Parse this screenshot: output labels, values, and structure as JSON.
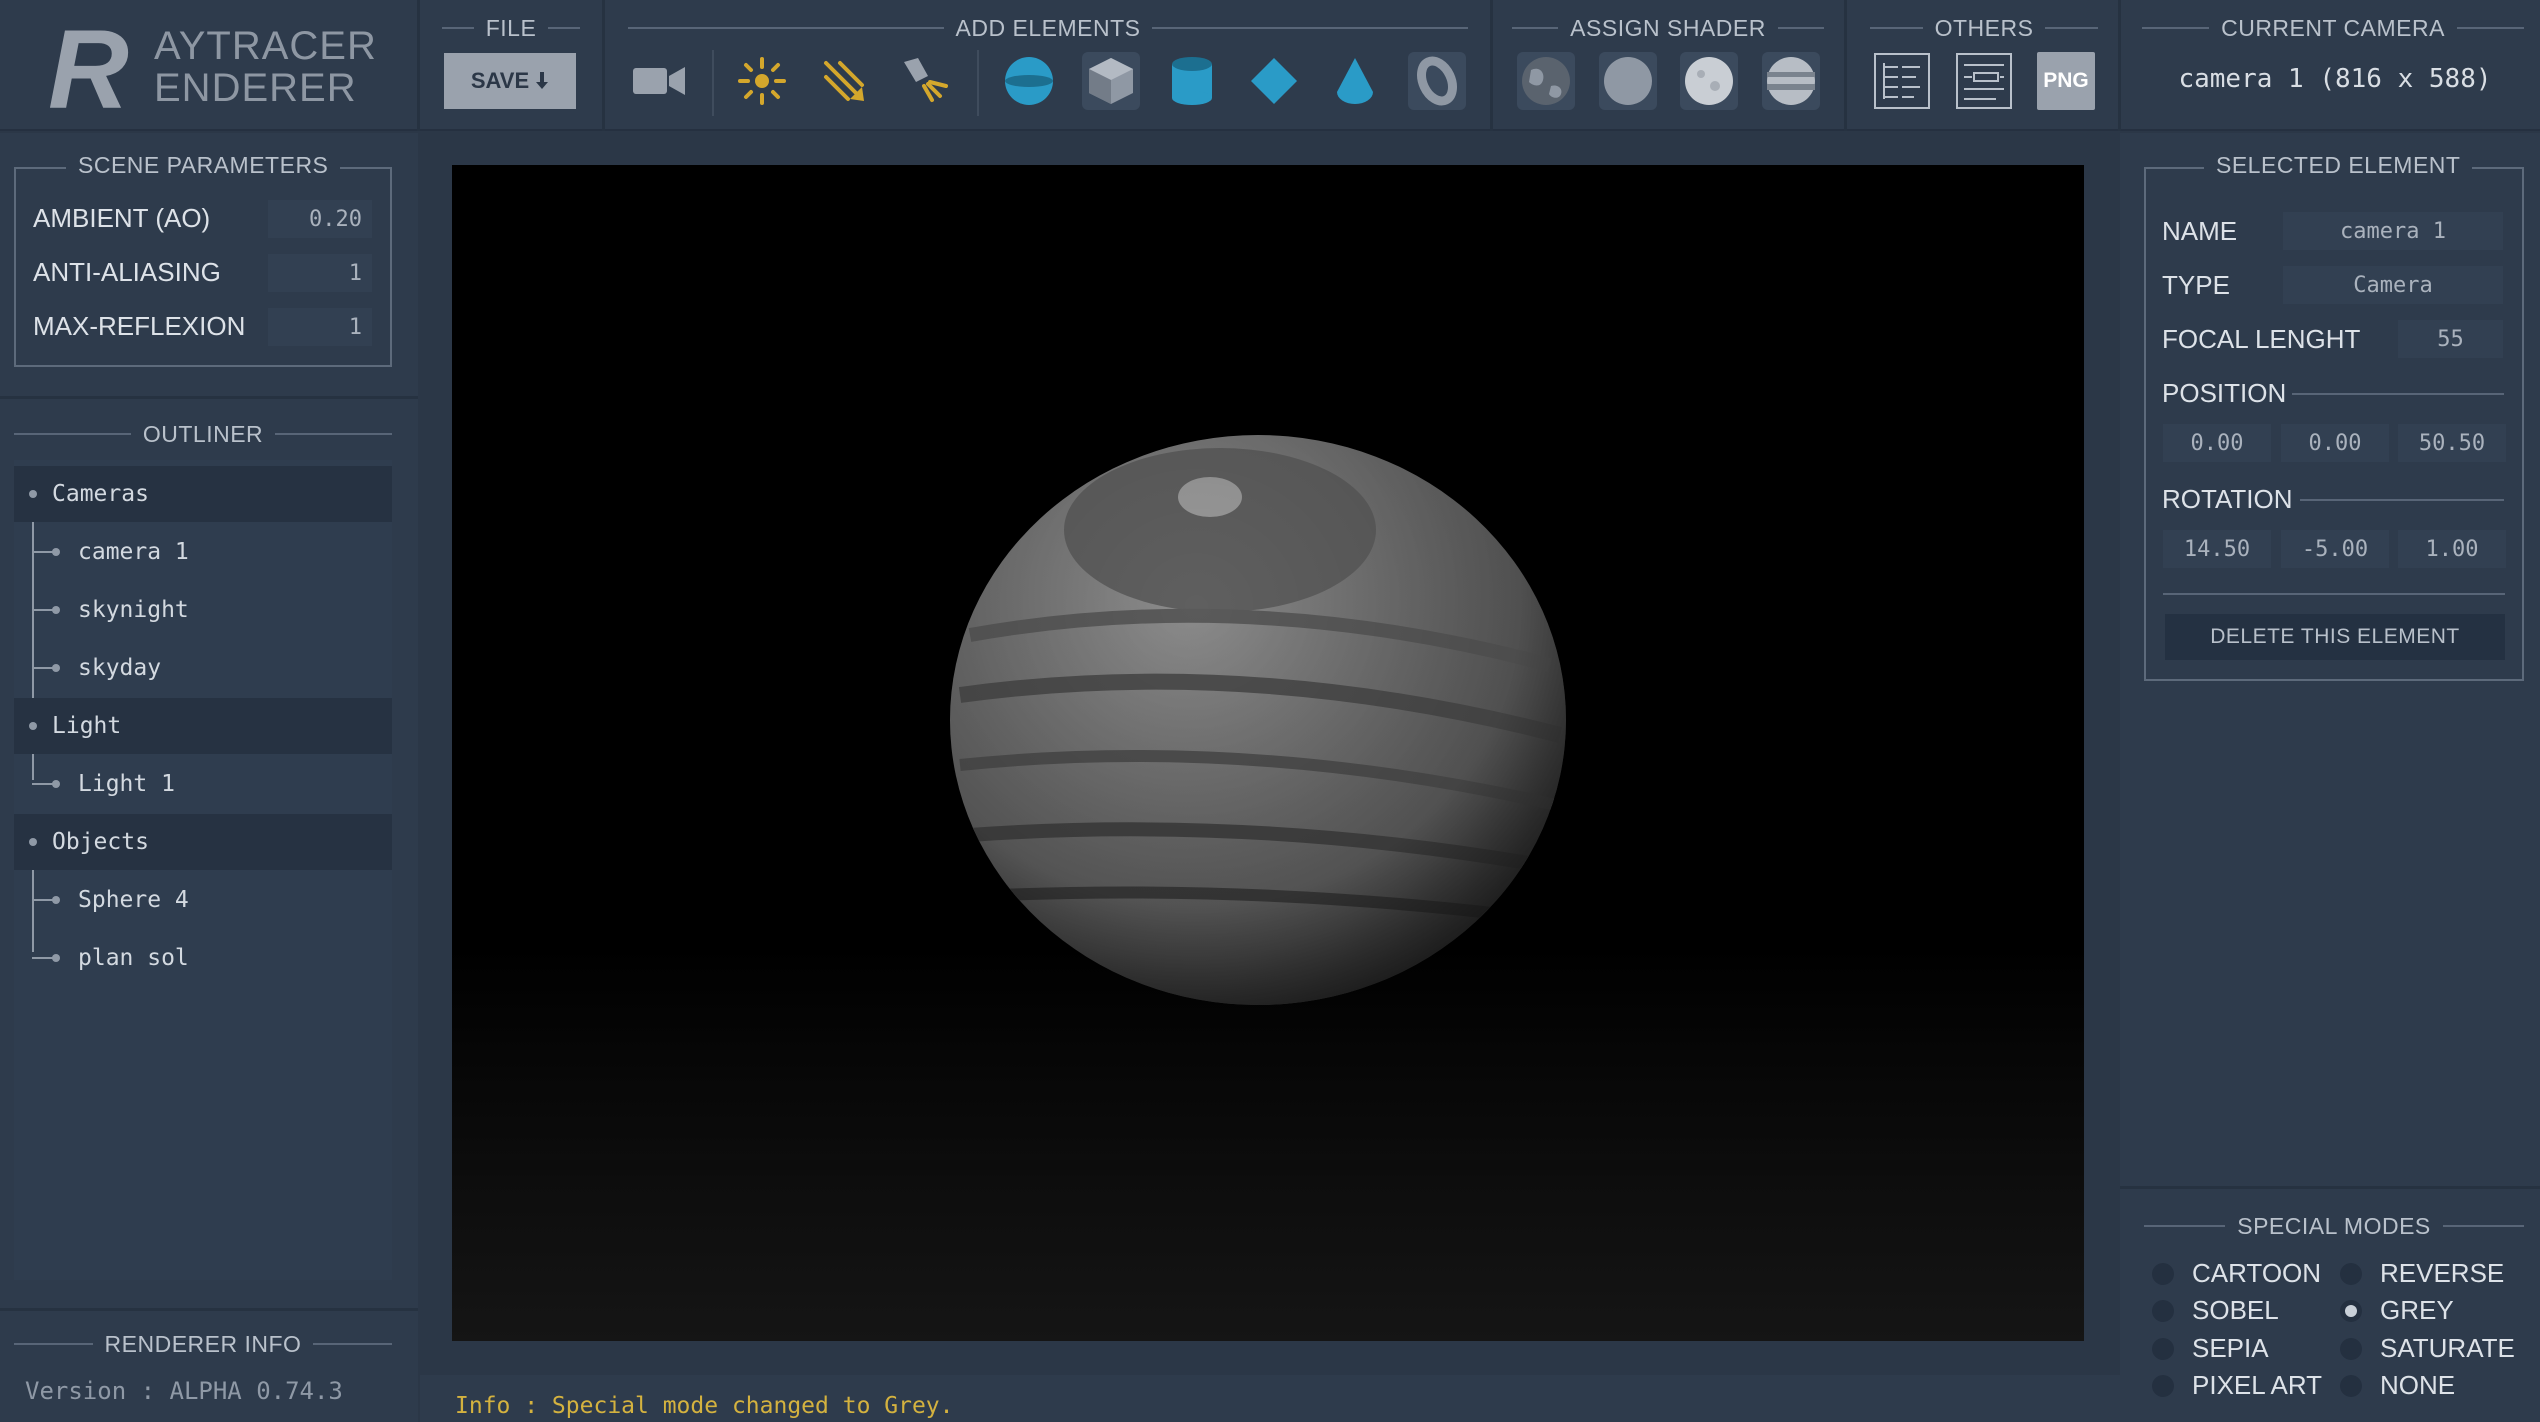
{
  "logo": {
    "letter": "R",
    "line1": "AYTRACER",
    "line2": "ENDERER"
  },
  "toolbar": {
    "file_title": "FILE",
    "save_label": "SAVE",
    "add_title": "ADD ELEMENTS",
    "shader_title": "ASSIGN SHADER",
    "others_title": "OTHERS",
    "png_label": "PNG",
    "camera_title": "CURRENT CAMERA",
    "camera_value": "camera 1 (816 x 588)",
    "add_icons": [
      "camera-icon",
      "point-light-icon",
      "directional-light-icon",
      "spot-light-icon",
      "sphere-icon",
      "cube-icon",
      "cylinder-icon",
      "plane-icon",
      "cone-icon",
      "torus-icon"
    ],
    "shader_icons": [
      "earth-shader-icon",
      "plain-shader-icon",
      "moon-shader-icon",
      "jupiter-shader-icon"
    ],
    "others_icons": [
      "outliner-list-icon",
      "properties-list-icon",
      "png-export-icon"
    ]
  },
  "scene": {
    "title": "SCENE PARAMETERS",
    "params": [
      {
        "label": "AMBIENT (AO)",
        "value": "0.20"
      },
      {
        "label": "ANTI-ALIASING",
        "value": "1"
      },
      {
        "label": "MAX-REFLEXION",
        "value": "1"
      }
    ]
  },
  "outliner": {
    "title": "OUTLINER",
    "groups": [
      {
        "label": "Cameras",
        "items": [
          "camera 1",
          "skynight",
          "skyday"
        ]
      },
      {
        "label": "Light",
        "items": [
          "Light 1"
        ]
      },
      {
        "label": "Objects",
        "items": [
          "Sphere 4",
          "plan sol"
        ]
      }
    ]
  },
  "renderer_info": {
    "title": "RENDERER INFO",
    "version": "Version : ALPHA 0.74.3"
  },
  "status": {
    "text": "Info : Special mode changed to Grey."
  },
  "selected": {
    "title": "SELECTED ELEMENT",
    "name_label": "NAME",
    "name_value": "camera 1",
    "type_label": "TYPE",
    "type_value": "Camera",
    "focal_label": "FOCAL LENGHT",
    "focal_value": "55",
    "position_label": "POSITION",
    "position": [
      "0.00",
      "0.00",
      "50.50"
    ],
    "rotation_label": "ROTATION",
    "rotation": [
      "14.50",
      "-5.00",
      "1.00"
    ],
    "delete_label": "DELETE THIS ELEMENT"
  },
  "special_modes": {
    "title": "SPECIAL MODES",
    "options": [
      {
        "label": "CARTOON",
        "checked": false
      },
      {
        "label": "REVERSE",
        "checked": false
      },
      {
        "label": "SOBEL",
        "checked": false
      },
      {
        "label": "GREY",
        "checked": true
      },
      {
        "label": "SEPIA",
        "checked": false
      },
      {
        "label": "SATURATE",
        "checked": false
      },
      {
        "label": "PIXEL ART",
        "checked": false
      },
      {
        "label": "NONE",
        "checked": false
      }
    ]
  },
  "colors": {
    "accent_yellow": "#d4a72c",
    "accent_blue": "#2a9bc7",
    "background": "#2b3747",
    "status_text": "#d4b23f"
  }
}
